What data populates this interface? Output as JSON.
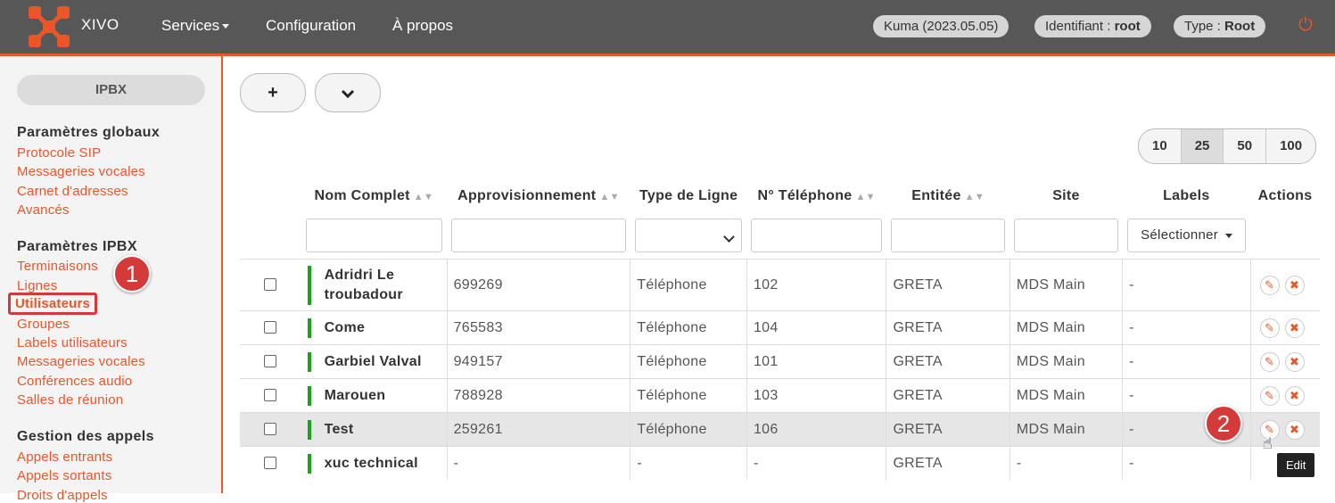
{
  "topbar": {
    "brand": "XIVO",
    "menu": [
      "Services",
      "Configuration",
      "À propos"
    ],
    "version": "Kuma (2023.05.05)",
    "identifiant_label": "Identifiant : ",
    "identifiant_value": "root",
    "type_label": "Type : ",
    "type_value": "Root",
    "accent_color": "#e8562a"
  },
  "sidebar": {
    "module_button": "IPBX",
    "sections": [
      {
        "title": "Paramètres globaux",
        "items": [
          "Protocole SIP",
          "Messageries vocales",
          "Carnet d'adresses",
          "Avancés"
        ]
      },
      {
        "title": "Paramètres IPBX",
        "items": [
          "Terminaisons",
          "Lignes",
          "Utilisateurs",
          "Groupes",
          "Labels utilisateurs",
          "Messageries vocales",
          "Conférences audio",
          "Salles de réunion"
        ]
      },
      {
        "title": "Gestion des appels",
        "items": [
          "Appels entrants",
          "Appels sortants",
          "Droits d'appels"
        ]
      }
    ],
    "active_item": "Utilisateurs"
  },
  "annotations": {
    "step1": "1",
    "step2": "2"
  },
  "toolbar": {
    "add_icon": "+",
    "dropdown_icon": "chevron-down"
  },
  "pager": {
    "options": [
      "10",
      "25",
      "50",
      "100"
    ],
    "selected": "25"
  },
  "table": {
    "columns": [
      "Nom Complet",
      "Approvisionnement",
      "Type de Ligne",
      "N° Téléphone",
      "Entitée",
      "Site",
      "Labels",
      "Actions"
    ],
    "labels_filter": "Sélectionner",
    "rows": [
      {
        "name": "Adridri Le troubadour",
        "provisioning": "699269",
        "line_type": "Téléphone",
        "number": "102",
        "entity": "GRETA",
        "site": "MDS Main",
        "labels": "-"
      },
      {
        "name": "Come",
        "provisioning": "765583",
        "line_type": "Téléphone",
        "number": "104",
        "entity": "GRETA",
        "site": "MDS Main",
        "labels": "-"
      },
      {
        "name": "Garbiel Valval",
        "provisioning": "949157",
        "line_type": "Téléphone",
        "number": "101",
        "entity": "GRETA",
        "site": "MDS Main",
        "labels": "-"
      },
      {
        "name": "Marouen",
        "provisioning": "788928",
        "line_type": "Téléphone",
        "number": "103",
        "entity": "GRETA",
        "site": "MDS Main",
        "labels": "-"
      },
      {
        "name": "Test",
        "provisioning": "259261",
        "line_type": "Téléphone",
        "number": "106",
        "entity": "GRETA",
        "site": "MDS Main",
        "labels": "-"
      },
      {
        "name": "xuc technical",
        "provisioning": "-",
        "line_type": "-",
        "number": "-",
        "entity": "GRETA",
        "site": "-",
        "labels": "-"
      }
    ]
  },
  "tooltip": "Edit"
}
